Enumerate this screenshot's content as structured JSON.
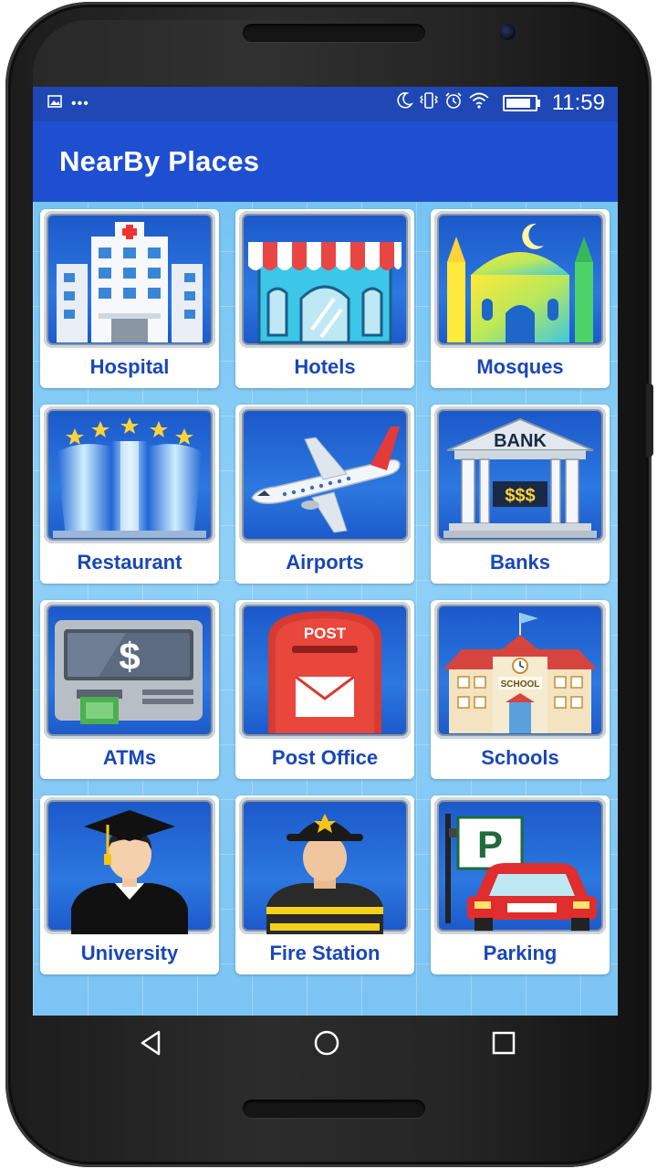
{
  "status_bar": {
    "time": "11:59",
    "left_icons": [
      "image-icon",
      "more-dots-icon"
    ],
    "right_icons": [
      "moon-icon",
      "vibrate-icon",
      "alarm-icon",
      "wifi-icon",
      "battery-icon"
    ]
  },
  "app_bar": {
    "title": "NearBy Places"
  },
  "places": [
    {
      "label": "Hospital",
      "icon": "hospital-icon"
    },
    {
      "label": "Hotels",
      "icon": "hotel-icon"
    },
    {
      "label": "Mosques",
      "icon": "mosque-icon"
    },
    {
      "label": "Restaurant",
      "icon": "restaurant-icon"
    },
    {
      "label": "Airports",
      "icon": "airplane-icon"
    },
    {
      "label": "Banks",
      "icon": "bank-icon"
    },
    {
      "label": "ATMs",
      "icon": "atm-icon"
    },
    {
      "label": "Post Office",
      "icon": "mailbox-icon"
    },
    {
      "label": "Schools",
      "icon": "school-icon"
    },
    {
      "label": "University",
      "icon": "graduate-icon"
    },
    {
      "label": "Fire Station",
      "icon": "firefighter-icon"
    },
    {
      "label": "Parking",
      "icon": "parking-icon"
    }
  ],
  "icon_text": {
    "bank_sign": "BANK",
    "bank_money": "$$$",
    "atm_dollar": "$",
    "post_sign": "POST",
    "school_sign": "SCHOOL",
    "parking_sign": "P"
  },
  "nav_bar": {
    "icons": [
      "back-icon",
      "home-icon",
      "recents-icon"
    ]
  },
  "colors": {
    "app_bar": "#1f4fd1",
    "status_bar": "#1f47b5",
    "label_text": "#1947b8",
    "background": "#7cc4f4"
  }
}
